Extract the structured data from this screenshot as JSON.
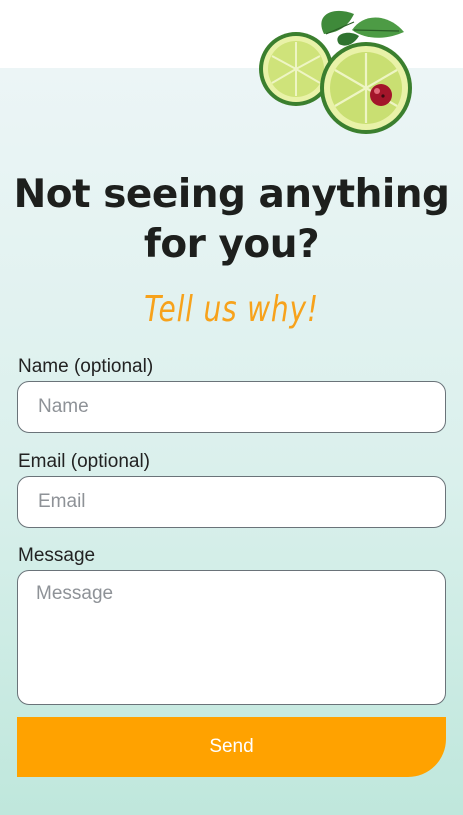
{
  "heading": {
    "line1": "Not seeing anything",
    "line2": "for you?"
  },
  "tagline": "Tell us why!",
  "form": {
    "name": {
      "label": "Name (optional)",
      "placeholder": "Name",
      "value": ""
    },
    "email": {
      "label": "Email (optional)",
      "placeholder": "Email",
      "value": ""
    },
    "message": {
      "label": "Message",
      "placeholder": "Message",
      "value": ""
    },
    "submit_label": "Send"
  },
  "colors": {
    "accent": "#ffa200",
    "tagline": "#f7a21b",
    "heading": "#1d1f1d",
    "panel_top": "#ecf5f6",
    "panel_bottom": "#bfe7dc"
  },
  "icons": {
    "garnish": "lime-slices-with-mint-and-cranberry-illustration"
  }
}
